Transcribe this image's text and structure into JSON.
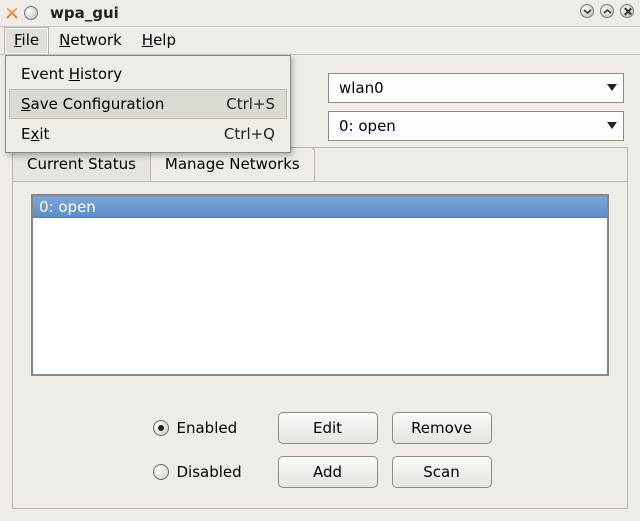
{
  "window": {
    "title": "wpa_gui"
  },
  "menubar": {
    "file": {
      "label": "File",
      "accel_index": 0
    },
    "network": {
      "label": "Network",
      "accel_index": 0
    },
    "help": {
      "label": "Help",
      "accel_index": 0
    }
  },
  "file_menu": {
    "event_history": {
      "label_pre": "Event ",
      "accel": "H",
      "label_post": "istory",
      "shortcut": ""
    },
    "save_config": {
      "label_pre": "",
      "accel": "S",
      "label_post": "ave Configuration",
      "shortcut": "Ctrl+S"
    },
    "exit": {
      "label_pre": "E",
      "accel": "x",
      "label_post": "it",
      "shortcut": "Ctrl+Q"
    }
  },
  "adapter_combo": {
    "value": "wlan0"
  },
  "network_combo": {
    "value": "0: open"
  },
  "tabs": {
    "current_status": {
      "label": "Current Status"
    },
    "manage_networks": {
      "label": "Manage Networks"
    }
  },
  "network_list": {
    "items": [
      "0: open"
    ]
  },
  "radios": {
    "enabled": {
      "label": "Enabled"
    },
    "disabled": {
      "label": "Disabled"
    }
  },
  "buttons": {
    "edit": {
      "label": "Edit"
    },
    "remove": {
      "label": "Remove"
    },
    "add": {
      "label": "Add"
    },
    "scan": {
      "label": "Scan"
    }
  }
}
